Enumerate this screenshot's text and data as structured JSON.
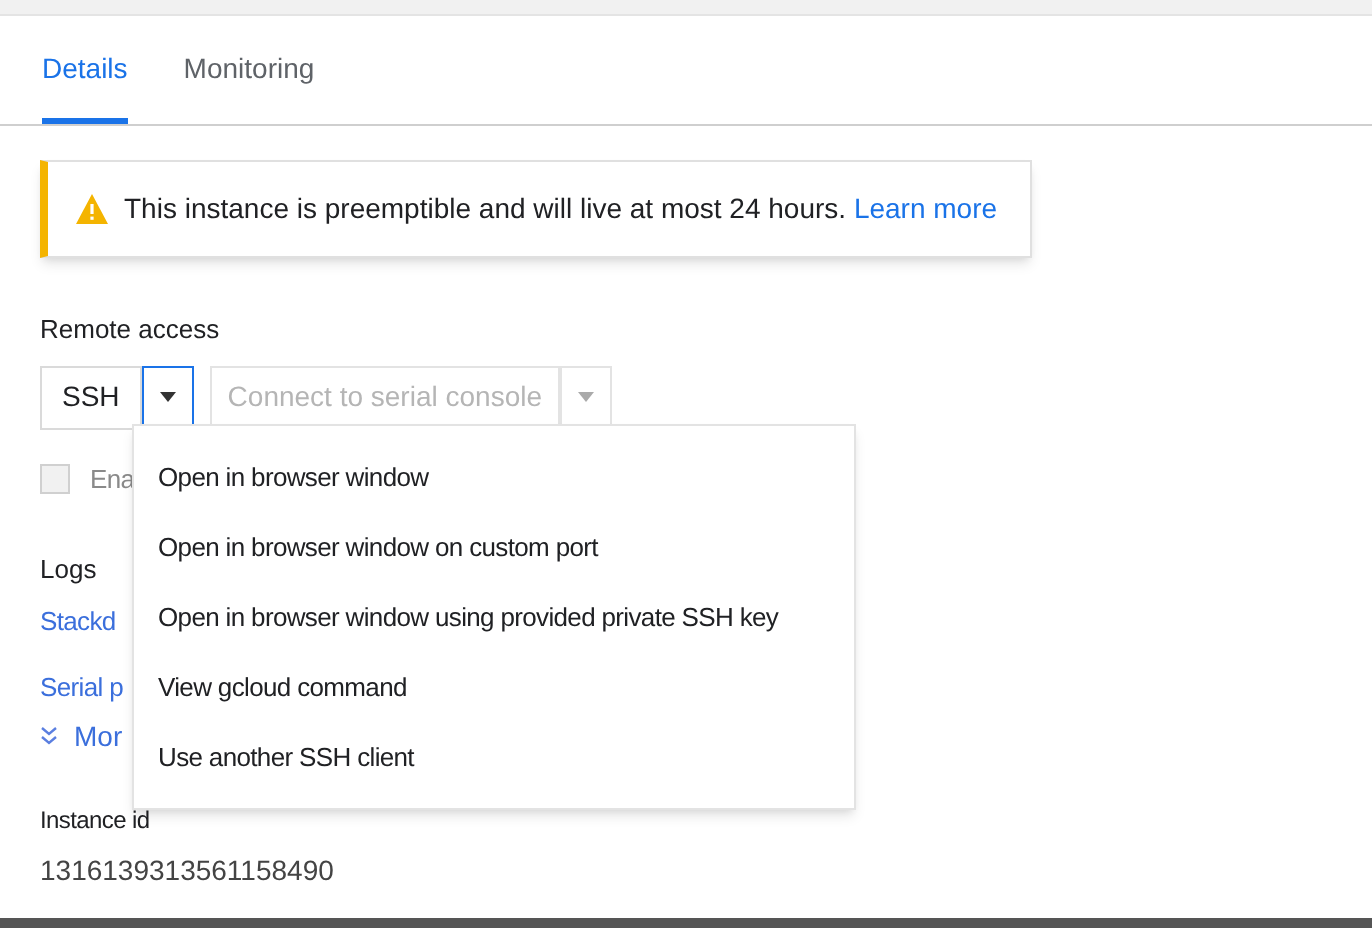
{
  "tabs": [
    {
      "label": "Details",
      "selected": true
    },
    {
      "label": "Monitoring",
      "selected": false
    }
  ],
  "banner": {
    "message": "This instance is preemptible and will live at most 24 hours.",
    "link": "Learn more"
  },
  "remote_access": {
    "label": "Remote access",
    "ssh_button": "SSH",
    "serial_button": "Connect to serial console",
    "serial_disabled": true,
    "checkbox_label": "Ena",
    "checked": false
  },
  "menu": {
    "open": true,
    "items": [
      "Open in browser window",
      "Open in browser window on custom port",
      "Open in browser window using provided private SSH key",
      "View gcloud command",
      "Use another SSH client"
    ]
  },
  "logs": {
    "label": "Logs",
    "links": [
      "Stackd",
      "Serial p"
    ],
    "more": "Mor"
  },
  "instance_id": {
    "label": "Instance id",
    "value": "1316139313561158490"
  }
}
